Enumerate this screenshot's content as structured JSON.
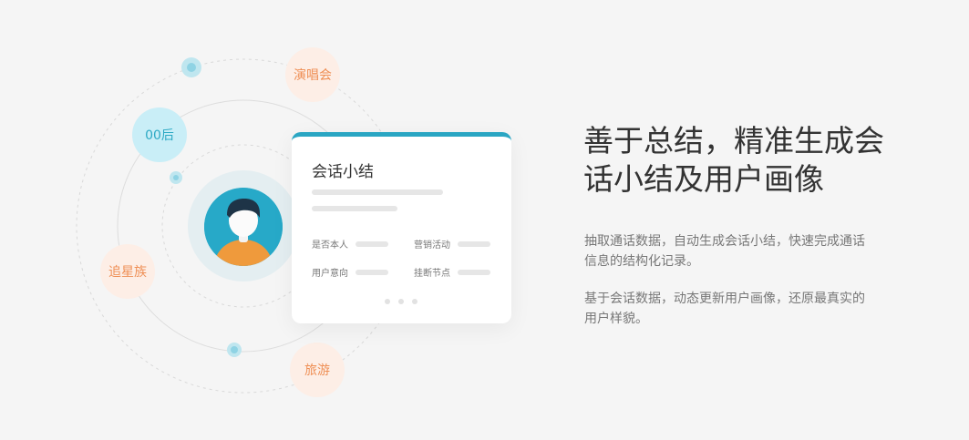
{
  "illustration": {
    "tags": {
      "concert": "演唱会",
      "post00": "00后",
      "fans": "追星族",
      "travel": "旅游"
    },
    "colors": {
      "accent": "#2aa6c3",
      "warm": "#ef8f55",
      "orbit": "#d6d6d6"
    }
  },
  "card": {
    "title": "会话小结",
    "fields": {
      "is_self": "是否本人",
      "marketing": "营销活动",
      "intent": "用户意向",
      "hangup": "挂断节点"
    }
  },
  "feature": {
    "headline_line1": "善于总结，精准生成会",
    "headline_line2": "话小结及用户画像",
    "desc1_line1": "抽取通话数据，自动生成会话小结，快速完成通话",
    "desc1_line2": "信息的结构化记录。",
    "desc2_line1": "基于会话数据，动态更新用户画像，还原最真实的",
    "desc2_line2": "用户样貌。"
  }
}
